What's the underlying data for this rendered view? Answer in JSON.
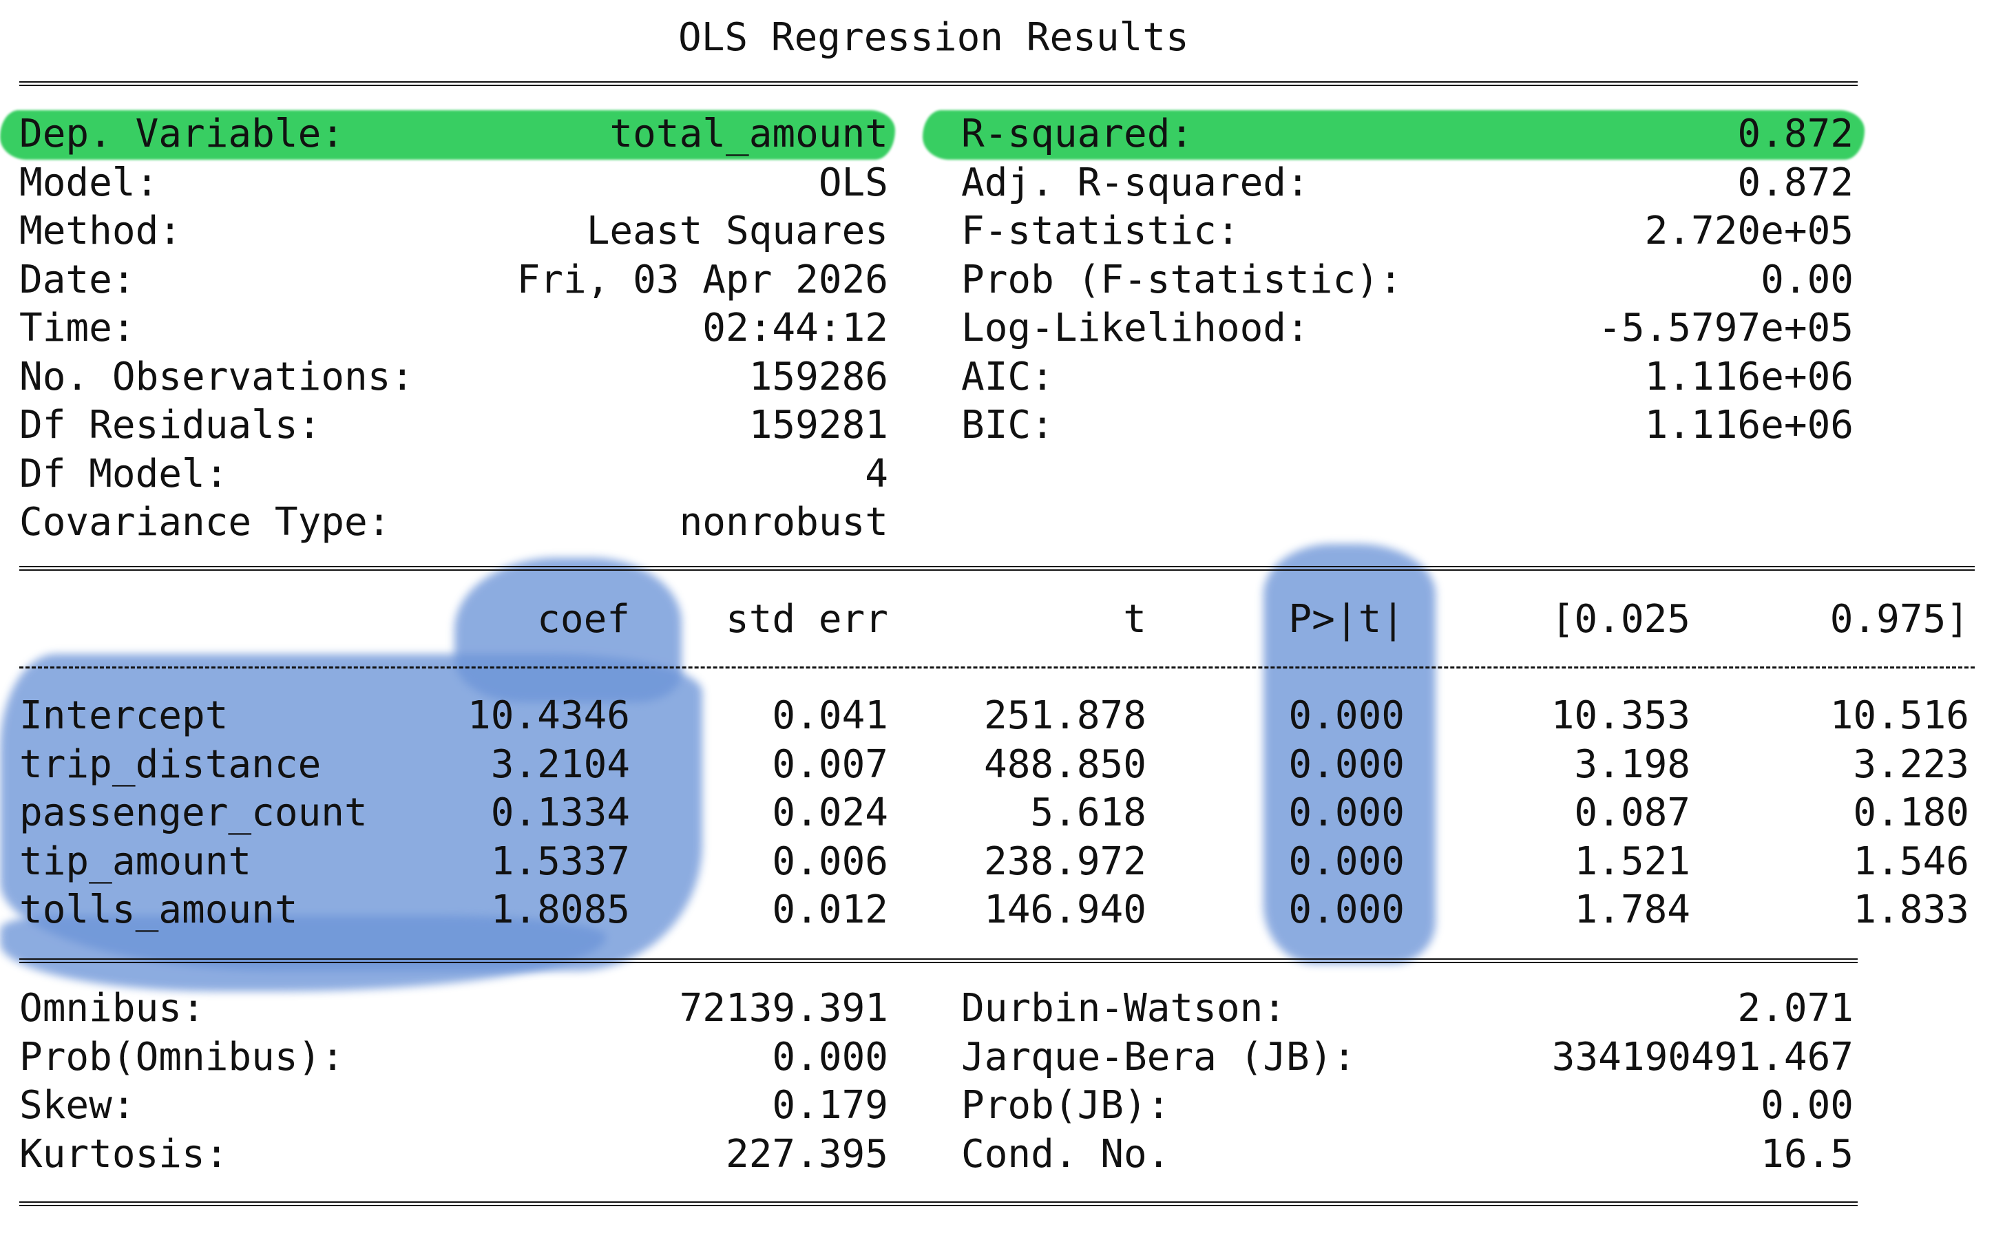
{
  "title": "OLS Regression Results",
  "header_left": [
    {
      "label": "Dep. Variable:",
      "value": "total_amount"
    },
    {
      "label": "Model:",
      "value": "OLS"
    },
    {
      "label": "Method:",
      "value": "Least Squares"
    },
    {
      "label": "Date:",
      "value": "Fri, 03 Apr 2026"
    },
    {
      "label": "Time:",
      "value": "02:44:12"
    },
    {
      "label": "No. Observations:",
      "value": "159286"
    },
    {
      "label": "Df Residuals:",
      "value": "159281"
    },
    {
      "label": "Df Model:",
      "value": "4"
    },
    {
      "label": "Covariance Type:",
      "value": "nonrobust"
    }
  ],
  "header_right": [
    {
      "label": "R-squared:",
      "value": "0.872"
    },
    {
      "label": "Adj. R-squared:",
      "value": "0.872"
    },
    {
      "label": "F-statistic:",
      "value": "2.720e+05"
    },
    {
      "label": "Prob (F-statistic):",
      "value": "0.00"
    },
    {
      "label": "Log-Likelihood:",
      "value": "-5.5797e+05"
    },
    {
      "label": "AIC:",
      "value": "1.116e+06"
    },
    {
      "label": "BIC:",
      "value": "1.116e+06"
    }
  ],
  "coef_table": {
    "columns": [
      "coef",
      "std err",
      "t",
      "P>|t|",
      "[0.025",
      "0.975]"
    ],
    "rows": [
      {
        "name": "Intercept",
        "values": [
          "10.4346",
          "0.041",
          "251.878",
          "0.000",
          "10.353",
          "10.516"
        ]
      },
      {
        "name": "trip_distance",
        "values": [
          "3.2104",
          "0.007",
          "488.850",
          "0.000",
          "3.198",
          "3.223"
        ]
      },
      {
        "name": "passenger_count",
        "values": [
          "0.1334",
          "0.024",
          "5.618",
          "0.000",
          "0.087",
          "0.180"
        ]
      },
      {
        "name": "tip_amount",
        "values": [
          "1.5337",
          "0.006",
          "238.972",
          "0.000",
          "1.521",
          "1.546"
        ]
      },
      {
        "name": "tolls_amount",
        "values": [
          "1.8085",
          "0.012",
          "146.940",
          "0.000",
          "1.784",
          "1.833"
        ]
      }
    ]
  },
  "footer_left": [
    {
      "label": "Omnibus:",
      "value": "72139.391"
    },
    {
      "label": "Prob(Omnibus):",
      "value": "0.000"
    },
    {
      "label": "Skew:",
      "value": "0.179"
    },
    {
      "label": "Kurtosis:",
      "value": "227.395"
    }
  ],
  "footer_right": [
    {
      "label": "Durbin-Watson:",
      "value": "2.071"
    },
    {
      "label": "Jarque-Bera (JB):",
      "value": "334190491.467"
    },
    {
      "label": "Prob(JB):",
      "value": "0.00"
    },
    {
      "label": "Cond. No.",
      "value": "16.5"
    }
  ],
  "highlight_color": "#2ecc5a",
  "watercolor_color": "#6d95d8"
}
